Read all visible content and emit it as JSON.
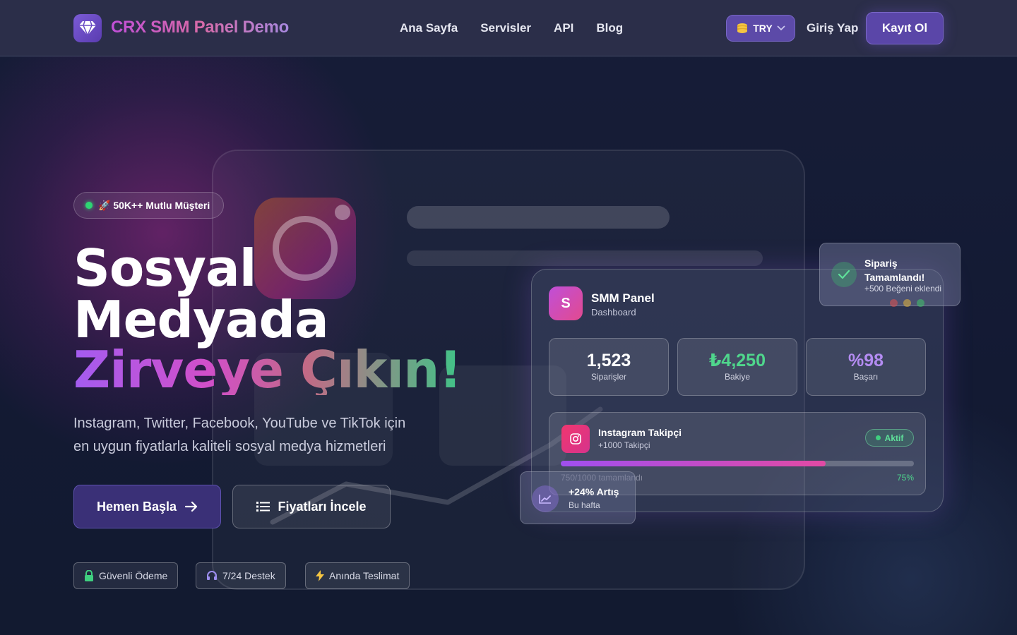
{
  "nav": {
    "brand": "CRX SMM Panel Demo",
    "links": [
      "Ana Sayfa",
      "Servisler",
      "API",
      "Blog"
    ],
    "currency": "TRY",
    "login": "Giriş Yap",
    "register": "Kayıt Ol"
  },
  "hero": {
    "badge": "🚀 50K++ Mutlu Müşteri",
    "title_line1": "Sosyal",
    "title_line2": "Medyada",
    "title_line3": "Zirveye Çıkın!",
    "subtitle_line1": "Instagram, Twitter, Facebook, YouTube ve TikTok için",
    "subtitle_line2": "en uygun fiyatlarla kaliteli sosyal medya hizmetleri",
    "btn_start": "Hemen Başla",
    "btn_prices": "Fiyatları İncele",
    "chips": [
      "Güvenli Ödeme",
      "7/24 Destek",
      "Anında Teslimat"
    ]
  },
  "dashboard": {
    "logo_letter": "S",
    "title": "SMM Panel",
    "subtitle": "Dashboard",
    "stats": [
      {
        "value": "1,523",
        "label": "Siparişler",
        "color": "#ffffff"
      },
      {
        "value": "₺4,250",
        "label": "Bakiye",
        "color": "#4fd68c"
      },
      {
        "value": "%98",
        "label": "Başarı",
        "color": "#b48cf2"
      }
    ],
    "service": {
      "title": "Instagram Takipçi",
      "subtitle": "+1000 Takipçi",
      "status": "Aktif",
      "progress_text": "750/1000 tamamlandı",
      "progress_pct_label": "75%",
      "progress": 0.75
    }
  },
  "notification": {
    "title": "Sipariş Tamamlandı!",
    "subtitle": "+500 Beğeni eklendi"
  },
  "growth": {
    "title": "+24% Artış",
    "subtitle": "Bu hafta"
  },
  "colors": {
    "accent": "#5a46a8",
    "success": "#4fd68c",
    "pink": "#e24a8f"
  }
}
